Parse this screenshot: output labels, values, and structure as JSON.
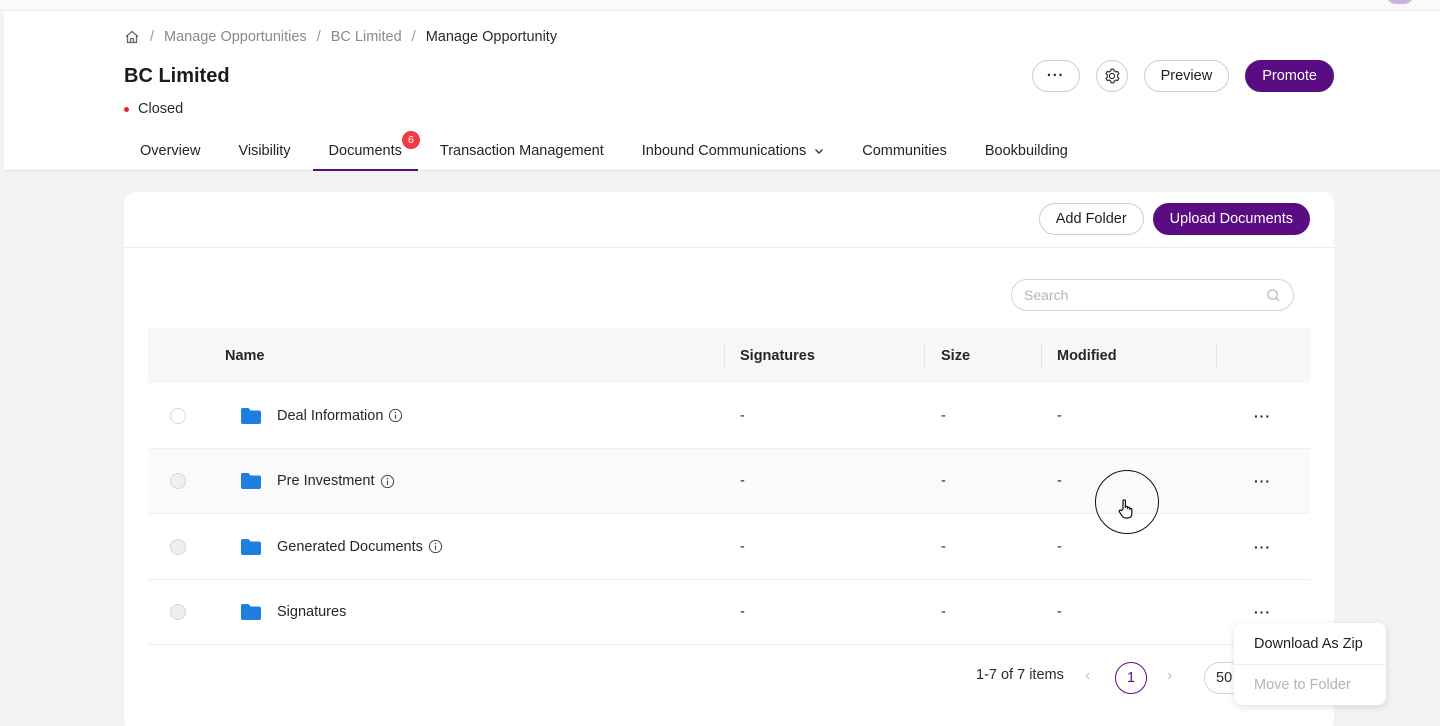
{
  "breadcrumb": {
    "home_icon": "home-icon",
    "items": [
      "Manage Opportunities",
      "BC Limited",
      "Manage Opportunity"
    ],
    "separator": "/"
  },
  "page": {
    "title": "BC Limited",
    "status": "Closed",
    "status_color": "#e8232f"
  },
  "actions": {
    "more_label": "···",
    "settings_icon": "gear-icon",
    "preview_label": "Preview",
    "promote_label": "Promote"
  },
  "tabs": [
    {
      "label": "Overview"
    },
    {
      "label": "Visibility"
    },
    {
      "label": "Documents",
      "badge": "6",
      "active": true
    },
    {
      "label": "Transaction Management"
    },
    {
      "label": "Inbound Communications",
      "has_dropdown": true
    },
    {
      "label": "Communities"
    },
    {
      "label": "Bookbuilding"
    }
  ],
  "toolbar": {
    "add_folder_label": "Add Folder",
    "upload_label": "Upload Documents"
  },
  "search": {
    "placeholder": "Search",
    "icon": "search-icon"
  },
  "table": {
    "columns": [
      "Name",
      "Signatures",
      "Size",
      "Modified"
    ],
    "rows": [
      {
        "name": "Deal Information",
        "signatures": "-",
        "size": "-",
        "modified": "-",
        "has_info": true
      },
      {
        "name": "Pre Investment",
        "signatures": "-",
        "size": "-",
        "modified": "-",
        "has_info": true
      },
      {
        "name": "Generated Documents",
        "signatures": "-",
        "size": "-",
        "modified": "-",
        "has_info": true
      },
      {
        "name": "Signatures",
        "signatures": "-",
        "size": "-",
        "modified": "-",
        "has_info": false
      }
    ],
    "row_action_label": "···"
  },
  "pagination": {
    "summary": "1-7 of 7 items",
    "prev": "‹",
    "next": "›",
    "current_page": "1",
    "page_size": "50"
  },
  "row_menu": {
    "items": [
      {
        "label": "Download As Zip",
        "disabled": false
      },
      {
        "label": "Move to Folder",
        "disabled": true
      }
    ]
  },
  "colors": {
    "primary": "#5a0d82",
    "badge": "#ef3b43",
    "folder": "#1f7fe0"
  }
}
